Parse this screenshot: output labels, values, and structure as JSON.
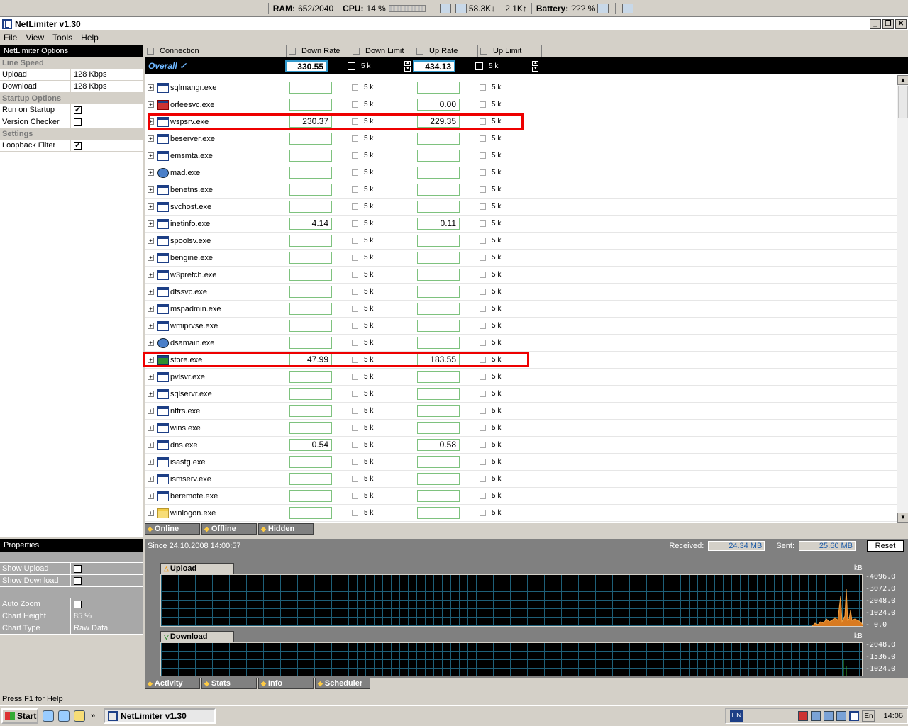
{
  "topbar": {
    "ram_label": "RAM:",
    "ram_value": "652/2040",
    "cpu_label": "CPU:",
    "cpu_value": "14 %",
    "down_speed": "58.3K",
    "up_speed": "2.1K",
    "battery_label": "Battery:",
    "battery_value": "??? %"
  },
  "window": {
    "title": "NetLimiter v1.30",
    "menu": [
      "File",
      "View",
      "Tools",
      "Help"
    ]
  },
  "options": {
    "title": "NetLimiter Options",
    "line_speed": "Line Speed",
    "upload_label": "Upload",
    "upload_value": "128 Kbps",
    "download_label": "Download",
    "download_value": "128 Kbps",
    "startup": "Startup Options",
    "run_on_startup": "Run on Startup",
    "version_checker": "Version Checker",
    "settings": "Settings",
    "loopback_filter": "Loopback Filter"
  },
  "grid": {
    "columns": [
      "Connection",
      "Down Rate",
      "Down Limit",
      "Up Rate",
      "Up Limit"
    ],
    "overall": {
      "label": "Overall",
      "down": "330.55",
      "down_limit": "5 k",
      "up": "434.13",
      "up_limit": "5 k"
    },
    "rows": [
      {
        "name": "sqlmangr.exe",
        "down": "",
        "up": "",
        "limit": "5 k",
        "icon": "window"
      },
      {
        "name": "orfeesvc.exe",
        "down": "",
        "up": "0.00",
        "limit": "5 k",
        "icon": "red"
      },
      {
        "name": "wspsrv.exe",
        "down": "230.37",
        "up": "229.35",
        "limit": "5 k",
        "icon": "window"
      },
      {
        "name": "beserver.exe",
        "down": "",
        "up": "",
        "limit": "5 k",
        "icon": "window"
      },
      {
        "name": "emsmta.exe",
        "down": "",
        "up": "",
        "limit": "5 k",
        "icon": "window"
      },
      {
        "name": "mad.exe",
        "down": "",
        "up": "",
        "limit": "5 k",
        "icon": "globe"
      },
      {
        "name": "benetns.exe",
        "down": "",
        "up": "",
        "limit": "5 k",
        "icon": "window"
      },
      {
        "name": "svchost.exe",
        "down": "",
        "up": "",
        "limit": "5 k",
        "icon": "window"
      },
      {
        "name": "inetinfo.exe",
        "down": "4.14",
        "up": "0.11",
        "limit": "5 k",
        "icon": "window"
      },
      {
        "name": "spoolsv.exe",
        "down": "",
        "up": "",
        "limit": "5 k",
        "icon": "window"
      },
      {
        "name": "bengine.exe",
        "down": "",
        "up": "",
        "limit": "5 k",
        "icon": "window"
      },
      {
        "name": "w3prefch.exe",
        "down": "",
        "up": "",
        "limit": "5 k",
        "icon": "window"
      },
      {
        "name": "dfssvc.exe",
        "down": "",
        "up": "",
        "limit": "5 k",
        "icon": "window"
      },
      {
        "name": "mspadmin.exe",
        "down": "",
        "up": "",
        "limit": "5 k",
        "icon": "window"
      },
      {
        "name": "wmiprvse.exe",
        "down": "",
        "up": "",
        "limit": "5 k",
        "icon": "window"
      },
      {
        "name": "dsamain.exe",
        "down": "",
        "up": "",
        "limit": "5 k",
        "icon": "globe"
      },
      {
        "name": "store.exe",
        "down": "47.99",
        "up": "183.55",
        "limit": "5 k",
        "icon": "green"
      },
      {
        "name": "pvlsvr.exe",
        "down": "",
        "up": "",
        "limit": "5 k",
        "icon": "window"
      },
      {
        "name": "sqlservr.exe",
        "down": "",
        "up": "",
        "limit": "5 k",
        "icon": "window"
      },
      {
        "name": "ntfrs.exe",
        "down": "",
        "up": "",
        "limit": "5 k",
        "icon": "window"
      },
      {
        "name": "wins.exe",
        "down": "",
        "up": "",
        "limit": "5 k",
        "icon": "window"
      },
      {
        "name": "dns.exe",
        "down": "0.54",
        "up": "0.58",
        "limit": "5 k",
        "icon": "window"
      },
      {
        "name": "isastg.exe",
        "down": "",
        "up": "",
        "limit": "5 k",
        "icon": "window"
      },
      {
        "name": "ismserv.exe",
        "down": "",
        "up": "",
        "limit": "5 k",
        "icon": "window"
      },
      {
        "name": "beremote.exe",
        "down": "",
        "up": "",
        "limit": "5 k",
        "icon": "window"
      },
      {
        "name": "winlogon.exe",
        "down": "",
        "up": "",
        "limit": "5 k",
        "icon": "folder"
      }
    ],
    "tabs": [
      "Online",
      "Offline",
      "Hidden"
    ]
  },
  "properties": {
    "title": "Properties",
    "show_upload": "Show Upload",
    "show_download": "Show Download",
    "auto_zoom": "Auto Zoom",
    "chart_height": "Chart Height",
    "chart_height_value": "85 %",
    "chart_type": "Chart Type",
    "chart_type_value": "Raw Data"
  },
  "stats": {
    "since": "Since 24.10.2008 14:00:57",
    "received_label": "Received:",
    "received_value": "24.34 MB",
    "sent_label": "Sent:",
    "sent_value": "25.60 MB",
    "reset": "Reset",
    "upload_chart": {
      "label": "Upload",
      "unit": "kB",
      "ticks": [
        "-4096.0",
        "-3072.0",
        "-2048.0",
        "-1024.0",
        "-   0.0"
      ]
    },
    "download_chart": {
      "label": "Download",
      "unit": "kB",
      "ticks": [
        "-2048.0",
        "-1536.0",
        "-1024.0"
      ]
    },
    "tabs": [
      "Activity",
      "Stats",
      "Info",
      "Scheduler"
    ]
  },
  "statusbar": "Press F1 for Help",
  "taskbar": {
    "start": "Start",
    "task": "NetLimiter v1.30",
    "lang": "EN",
    "lang2": "En",
    "clock": "14:06"
  }
}
